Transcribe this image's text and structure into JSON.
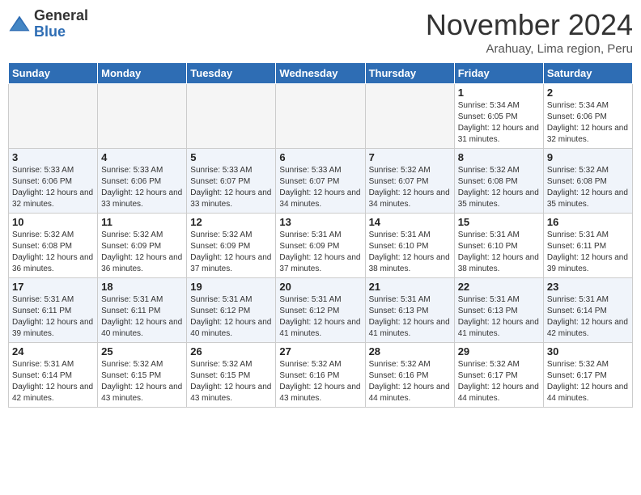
{
  "logo": {
    "general": "General",
    "blue": "Blue"
  },
  "title": "November 2024",
  "location": "Arahuay, Lima region, Peru",
  "weekdays": [
    "Sunday",
    "Monday",
    "Tuesday",
    "Wednesday",
    "Thursday",
    "Friday",
    "Saturday"
  ],
  "weeks": [
    [
      {
        "day": "",
        "info": ""
      },
      {
        "day": "",
        "info": ""
      },
      {
        "day": "",
        "info": ""
      },
      {
        "day": "",
        "info": ""
      },
      {
        "day": "",
        "info": ""
      },
      {
        "day": "1",
        "info": "Sunrise: 5:34 AM\nSunset: 6:05 PM\nDaylight: 12 hours and 31 minutes."
      },
      {
        "day": "2",
        "info": "Sunrise: 5:34 AM\nSunset: 6:06 PM\nDaylight: 12 hours and 32 minutes."
      }
    ],
    [
      {
        "day": "3",
        "info": "Sunrise: 5:33 AM\nSunset: 6:06 PM\nDaylight: 12 hours and 32 minutes."
      },
      {
        "day": "4",
        "info": "Sunrise: 5:33 AM\nSunset: 6:06 PM\nDaylight: 12 hours and 33 minutes."
      },
      {
        "day": "5",
        "info": "Sunrise: 5:33 AM\nSunset: 6:07 PM\nDaylight: 12 hours and 33 minutes."
      },
      {
        "day": "6",
        "info": "Sunrise: 5:33 AM\nSunset: 6:07 PM\nDaylight: 12 hours and 34 minutes."
      },
      {
        "day": "7",
        "info": "Sunrise: 5:32 AM\nSunset: 6:07 PM\nDaylight: 12 hours and 34 minutes."
      },
      {
        "day": "8",
        "info": "Sunrise: 5:32 AM\nSunset: 6:08 PM\nDaylight: 12 hours and 35 minutes."
      },
      {
        "day": "9",
        "info": "Sunrise: 5:32 AM\nSunset: 6:08 PM\nDaylight: 12 hours and 35 minutes."
      }
    ],
    [
      {
        "day": "10",
        "info": "Sunrise: 5:32 AM\nSunset: 6:08 PM\nDaylight: 12 hours and 36 minutes."
      },
      {
        "day": "11",
        "info": "Sunrise: 5:32 AM\nSunset: 6:09 PM\nDaylight: 12 hours and 36 minutes."
      },
      {
        "day": "12",
        "info": "Sunrise: 5:32 AM\nSunset: 6:09 PM\nDaylight: 12 hours and 37 minutes."
      },
      {
        "day": "13",
        "info": "Sunrise: 5:31 AM\nSunset: 6:09 PM\nDaylight: 12 hours and 37 minutes."
      },
      {
        "day": "14",
        "info": "Sunrise: 5:31 AM\nSunset: 6:10 PM\nDaylight: 12 hours and 38 minutes."
      },
      {
        "day": "15",
        "info": "Sunrise: 5:31 AM\nSunset: 6:10 PM\nDaylight: 12 hours and 38 minutes."
      },
      {
        "day": "16",
        "info": "Sunrise: 5:31 AM\nSunset: 6:11 PM\nDaylight: 12 hours and 39 minutes."
      }
    ],
    [
      {
        "day": "17",
        "info": "Sunrise: 5:31 AM\nSunset: 6:11 PM\nDaylight: 12 hours and 39 minutes."
      },
      {
        "day": "18",
        "info": "Sunrise: 5:31 AM\nSunset: 6:11 PM\nDaylight: 12 hours and 40 minutes."
      },
      {
        "day": "19",
        "info": "Sunrise: 5:31 AM\nSunset: 6:12 PM\nDaylight: 12 hours and 40 minutes."
      },
      {
        "day": "20",
        "info": "Sunrise: 5:31 AM\nSunset: 6:12 PM\nDaylight: 12 hours and 41 minutes."
      },
      {
        "day": "21",
        "info": "Sunrise: 5:31 AM\nSunset: 6:13 PM\nDaylight: 12 hours and 41 minutes."
      },
      {
        "day": "22",
        "info": "Sunrise: 5:31 AM\nSunset: 6:13 PM\nDaylight: 12 hours and 41 minutes."
      },
      {
        "day": "23",
        "info": "Sunrise: 5:31 AM\nSunset: 6:14 PM\nDaylight: 12 hours and 42 minutes."
      }
    ],
    [
      {
        "day": "24",
        "info": "Sunrise: 5:31 AM\nSunset: 6:14 PM\nDaylight: 12 hours and 42 minutes."
      },
      {
        "day": "25",
        "info": "Sunrise: 5:32 AM\nSunset: 6:15 PM\nDaylight: 12 hours and 43 minutes."
      },
      {
        "day": "26",
        "info": "Sunrise: 5:32 AM\nSunset: 6:15 PM\nDaylight: 12 hours and 43 minutes."
      },
      {
        "day": "27",
        "info": "Sunrise: 5:32 AM\nSunset: 6:16 PM\nDaylight: 12 hours and 43 minutes."
      },
      {
        "day": "28",
        "info": "Sunrise: 5:32 AM\nSunset: 6:16 PM\nDaylight: 12 hours and 44 minutes."
      },
      {
        "day": "29",
        "info": "Sunrise: 5:32 AM\nSunset: 6:17 PM\nDaylight: 12 hours and 44 minutes."
      },
      {
        "day": "30",
        "info": "Sunrise: 5:32 AM\nSunset: 6:17 PM\nDaylight: 12 hours and 44 minutes."
      }
    ]
  ]
}
